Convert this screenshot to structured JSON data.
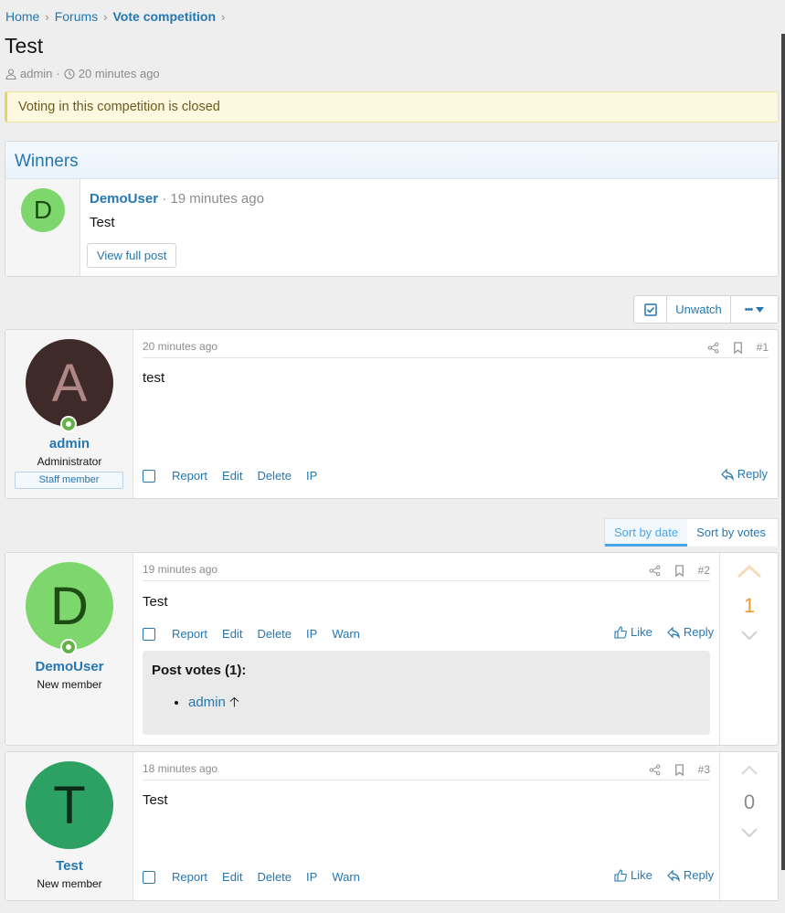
{
  "breadcrumb": [
    "Home",
    "Forums",
    "Vote competition"
  ],
  "thread": {
    "title": "Test",
    "author": "admin",
    "time": "20 minutes ago"
  },
  "notice": "Voting in this competition is closed",
  "winners": {
    "heading": "Winners",
    "avatar_letter": "D",
    "user": "DemoUser",
    "time_sep": " · 19 minutes ago",
    "text": "Test",
    "button": "View full post"
  },
  "watch": {
    "unwatch": "Unwatch",
    "more": "•••"
  },
  "sort": {
    "by_date": "Sort by date",
    "by_votes": "Sort by votes"
  },
  "actions": {
    "report": "Report",
    "edit": "Edit",
    "delete": "Delete",
    "ip": "IP",
    "warn": "Warn",
    "like": "Like",
    "reply": "Reply"
  },
  "posts": [
    {
      "avatar_letter": "A",
      "avatar_color": "#3f2a2a",
      "avatar_text_color": "#b08787",
      "user": "admin",
      "user_title": "Administrator",
      "badge": "Staff member",
      "time": "20 minutes ago",
      "num": "#1",
      "text": "test"
    },
    {
      "avatar_letter": "D",
      "avatar_color": "#7dd76c",
      "avatar_text_color": "#1d4d14",
      "user": "DemoUser",
      "user_title": "New member",
      "time": "19 minutes ago",
      "num": "#2",
      "text": "Test",
      "votes": "1",
      "votes_title": "Post votes (1):",
      "voter": "admin",
      "voter_arrow": "🡡"
    },
    {
      "avatar_letter": "T",
      "avatar_color": "#2da064",
      "avatar_text_color": "#0b2a18",
      "user": "Test",
      "user_title": "New member",
      "time": "18 minutes ago",
      "num": "#3",
      "text": "Test",
      "votes": "0"
    }
  ]
}
